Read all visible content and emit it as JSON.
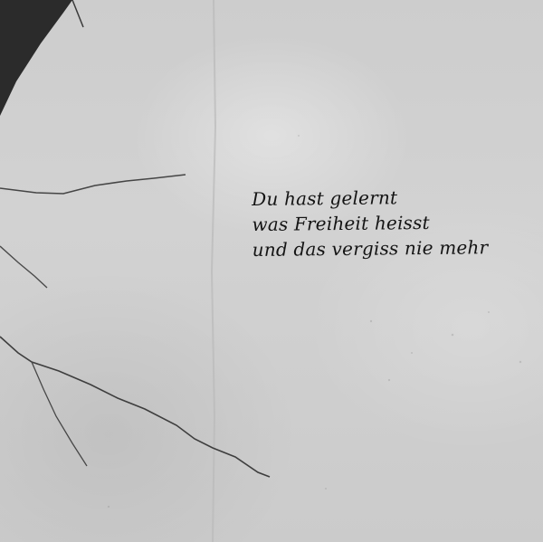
{
  "wall_text": {
    "lines": [
      "Du hast gelernt",
      "was Freiheit heisst",
      "und das vergiss nie mehr"
    ]
  },
  "colors": {
    "wall": "#cfcfcf",
    "ink": "#141414",
    "shadow": "#2b2b2b"
  }
}
